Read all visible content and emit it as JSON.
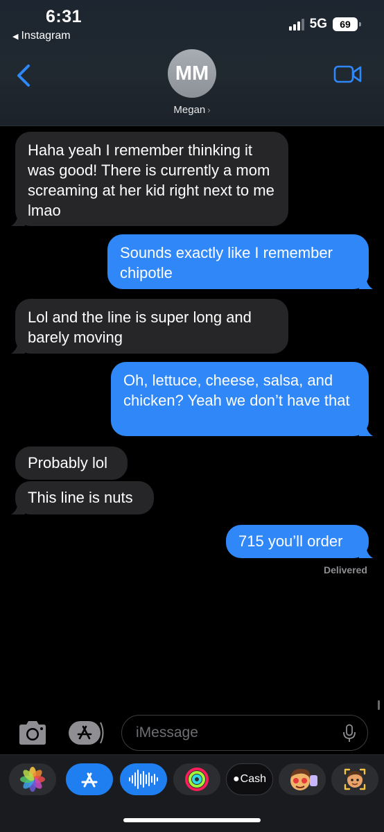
{
  "status_bar": {
    "time": "6:31",
    "back_app": "Instagram",
    "network": "5G",
    "battery": "69"
  },
  "header": {
    "avatar_initials": "MM",
    "contact_name": "Megan",
    "accent_color": "#2f87f8"
  },
  "messages": [
    {
      "direction": "incoming",
      "text": "Haha yeah I remember thinking it was good! There is currently a mom screaming at her kid right next to me lmao"
    },
    {
      "direction": "outgoing",
      "text": "Sounds exactly like I remember chipotle"
    },
    {
      "direction": "incoming",
      "text": "Lol and the line is super long and barely moving"
    },
    {
      "direction": "outgoing",
      "text": "Oh, lettuce, cheese, salsa, and chicken? Yeah we don’t have that"
    },
    {
      "direction": "incoming",
      "text": "Probably lol"
    },
    {
      "direction": "incoming",
      "text": "This line is nuts"
    },
    {
      "direction": "outgoing",
      "text": "715 you’ll order"
    }
  ],
  "delivery_status": "Delivered",
  "compose": {
    "placeholder": "iMessage"
  },
  "app_drawer": [
    {
      "name": "photos-app",
      "label": ""
    },
    {
      "name": "app-store-app",
      "label": ""
    },
    {
      "name": "audio-message-app",
      "label": ""
    },
    {
      "name": "activity-app",
      "label": ""
    },
    {
      "name": "apple-cash-app",
      "label": "Cash"
    },
    {
      "name": "memoji-stickers-app",
      "label": ""
    },
    {
      "name": "animoji-app",
      "label": ""
    }
  ]
}
